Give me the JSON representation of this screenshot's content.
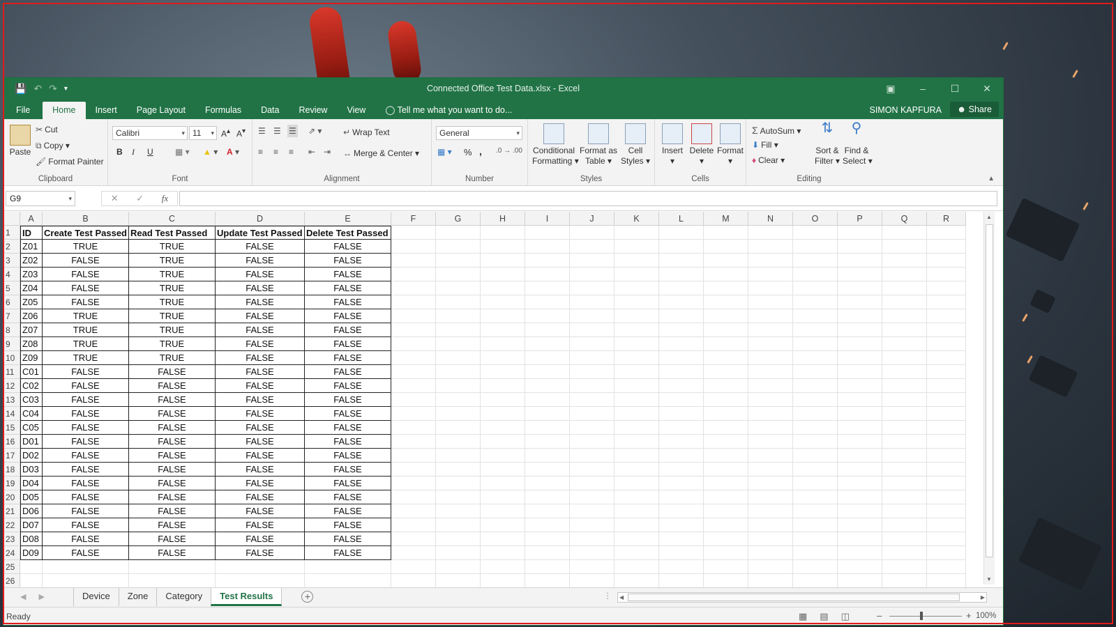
{
  "window": {
    "title": "Connected Office Test Data.xlsx - Excel",
    "user": "SIMON KAPFURA",
    "share_label": "Share"
  },
  "qat": {
    "save_icon": "save-icon",
    "undo_icon": "undo-icon",
    "redo_icon": "redo-icon"
  },
  "tabs": [
    {
      "label": "File"
    },
    {
      "label": "Home",
      "active": true
    },
    {
      "label": "Insert"
    },
    {
      "label": "Page Layout"
    },
    {
      "label": "Formulas"
    },
    {
      "label": "Data"
    },
    {
      "label": "Review"
    },
    {
      "label": "View"
    }
  ],
  "tell_me": "Tell me what you want to do...",
  "ribbon": {
    "clipboard": {
      "paste": "Paste",
      "cut": "Cut",
      "copy": "Copy",
      "format_painter": "Format Painter",
      "label": "Clipboard"
    },
    "font": {
      "name": "Calibri",
      "size": "11",
      "bold": "B",
      "italic": "I",
      "underline": "U",
      "label": "Font"
    },
    "alignment": {
      "wrap_text": "Wrap Text",
      "merge_center": "Merge & Center",
      "label": "Alignment"
    },
    "number": {
      "format": "General",
      "percent": "%",
      "comma": ",",
      "label": "Number"
    },
    "styles": {
      "conditional_1": "Conditional",
      "conditional_2": "Formatting",
      "format_table_1": "Format as",
      "format_table_2": "Table",
      "cell_styles_1": "Cell",
      "cell_styles_2": "Styles",
      "label": "Styles"
    },
    "cells": {
      "insert": "Insert",
      "delete": "Delete",
      "format": "Format",
      "label": "Cells"
    },
    "editing": {
      "autosum": "AutoSum",
      "fill": "Fill",
      "clear": "Clear",
      "sort_1": "Sort &",
      "sort_2": "Filter",
      "find_1": "Find &",
      "find_2": "Select",
      "label": "Editing"
    }
  },
  "formula_bar": {
    "name_box": "G9",
    "fx": "fx",
    "value": ""
  },
  "columns": [
    "A",
    "B",
    "C",
    "D",
    "E",
    "F",
    "G",
    "H",
    "I",
    "J",
    "K",
    "L",
    "M",
    "N",
    "O",
    "P",
    "Q",
    "R"
  ],
  "headers": [
    "ID",
    "Create Test Passed",
    "Read Test Passed",
    "Update Test Passed",
    "Delete Test Passed"
  ],
  "rows": [
    [
      "Z01",
      "TRUE",
      "TRUE",
      "FALSE",
      "FALSE"
    ],
    [
      "Z02",
      "FALSE",
      "TRUE",
      "FALSE",
      "FALSE"
    ],
    [
      "Z03",
      "FALSE",
      "TRUE",
      "FALSE",
      "FALSE"
    ],
    [
      "Z04",
      "FALSE",
      "TRUE",
      "FALSE",
      "FALSE"
    ],
    [
      "Z05",
      "FALSE",
      "TRUE",
      "FALSE",
      "FALSE"
    ],
    [
      "Z06",
      "TRUE",
      "TRUE",
      "FALSE",
      "FALSE"
    ],
    [
      "Z07",
      "TRUE",
      "TRUE",
      "FALSE",
      "FALSE"
    ],
    [
      "Z08",
      "TRUE",
      "TRUE",
      "FALSE",
      "FALSE"
    ],
    [
      "Z09",
      "TRUE",
      "TRUE",
      "FALSE",
      "FALSE"
    ],
    [
      "C01",
      "FALSE",
      "FALSE",
      "FALSE",
      "FALSE"
    ],
    [
      "C02",
      "FALSE",
      "FALSE",
      "FALSE",
      "FALSE"
    ],
    [
      "C03",
      "FALSE",
      "FALSE",
      "FALSE",
      "FALSE"
    ],
    [
      "C04",
      "FALSE",
      "FALSE",
      "FALSE",
      "FALSE"
    ],
    [
      "C05",
      "FALSE",
      "FALSE",
      "FALSE",
      "FALSE"
    ],
    [
      "D01",
      "FALSE",
      "FALSE",
      "FALSE",
      "FALSE"
    ],
    [
      "D02",
      "FALSE",
      "FALSE",
      "FALSE",
      "FALSE"
    ],
    [
      "D03",
      "FALSE",
      "FALSE",
      "FALSE",
      "FALSE"
    ],
    [
      "D04",
      "FALSE",
      "FALSE",
      "FALSE",
      "FALSE"
    ],
    [
      "D05",
      "FALSE",
      "FALSE",
      "FALSE",
      "FALSE"
    ],
    [
      "D06",
      "FALSE",
      "FALSE",
      "FALSE",
      "FALSE"
    ],
    [
      "D07",
      "FALSE",
      "FALSE",
      "FALSE",
      "FALSE"
    ],
    [
      "D08",
      "FALSE",
      "FALSE",
      "FALSE",
      "FALSE"
    ],
    [
      "D09",
      "FALSE",
      "FALSE",
      "FALSE",
      "FALSE"
    ]
  ],
  "extra_row_numbers": [
    "25",
    "26"
  ],
  "sheets": [
    {
      "label": "Device"
    },
    {
      "label": "Zone"
    },
    {
      "label": "Category"
    },
    {
      "label": "Test Results",
      "active": true
    }
  ],
  "status": {
    "text": "Ready",
    "zoom": "100%"
  },
  "colors": {
    "excel_green": "#217346",
    "title_green": "#217346"
  }
}
